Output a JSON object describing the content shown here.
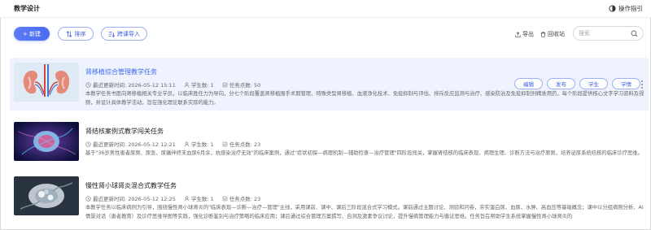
{
  "header": {
    "title": "教学设计",
    "guide_label": "操作指引"
  },
  "toolbar": {
    "new_label": "+ 新建",
    "sort_label": "排序",
    "import_label": "跨课导入",
    "export_label": "导出",
    "recycle_label": "回收站",
    "search_placeholder": "搜索"
  },
  "tasks": [
    {
      "title": "肾移植综合管理教学任务",
      "updated": "最近更新时间: 2026-05-12 15:11",
      "students": "学生数: 1",
      "points": "任务点数: 50",
      "desc": "本教学任务书面向肾移植相关专业学员，以临床胜任力为导向，分七个阶段覆盖肾移植围手术期管理、特殊类型肾移植、血液净化技术、免疫抑制与评估、排斥反应监测与治疗、感染防治及免疫抑制剂精准用药，每个阶段提供核心文字学习资料及视频，并设计具体教学活动，旨在强化理论联系实际的能力。",
      "actions": [
        "编辑",
        "发布",
        "学生",
        "学情"
      ]
    },
    {
      "title": "肾结核案例式教学闯关任务",
      "updated": "最近更新时间: 2026-05-12 12:21",
      "students": "学生数: 1",
      "points": "任务点数: 23",
      "desc": "基于\"36岁男性患者尿频、尿急、尿痛伴终末血尿6月余，抗感染治疗无效\"的临床案例，通过\"症状初探—病理机制—辅助检查—治疗管理\"四阶段闯关，掌握肾结核的临床表现、病理生理、诊断方法与治疗原则，培养泌尿系统结核的临床诊疗思维。"
    },
    {
      "title": "慢性肾小球肾炎混合式教学任务",
      "updated": "最近更新时间: 2026-05-12 12:25",
      "students": "学生数: 1",
      "points": "任务点数: 23",
      "desc": "本教学任务以临床病例为引导，围绕慢性肾小球肾炎的\"临床表现—诊断—治疗—管理\"主线，采用课前、课中、课后三阶段混合式学习模式。课前通过主题讨论、测验和问卷，夯实蛋白尿、血尿、水肿、高血压等基础概念；课中以分组病例分析、AI情景对话（患者教育）及诊疗思维导图等实践，强化诊断鉴别与治疗策略的临床应用；课后通过综合管理方案撰写、自测及激素争议讨论，提升慢病管理能力与循证思维。任务旨在帮助学生系统掌握慢性肾小球肾炎的"
    }
  ],
  "colors": {
    "accent": "#4a6cf0",
    "active_row_bg": "#eef3fd",
    "title_link": "#3d6bf0"
  }
}
